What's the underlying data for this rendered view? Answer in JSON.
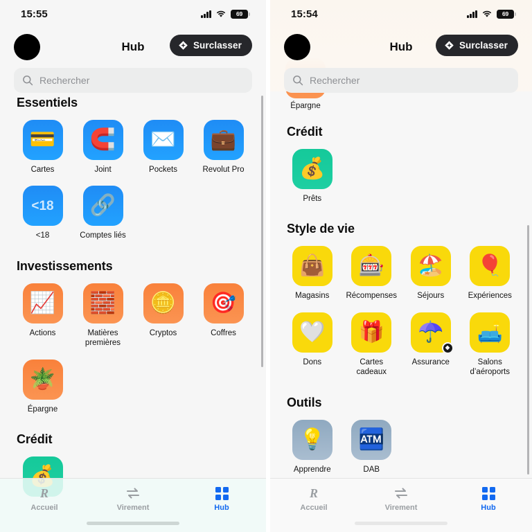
{
  "app": {
    "name": "Revolut",
    "screen": "Hub"
  },
  "left": {
    "status": {
      "time": "15:55",
      "battery": "69",
      "signal_icon": "cellular-signal-icon",
      "wifi_icon": "wifi-icon",
      "battery_icon": "battery-icon"
    },
    "header": {
      "title": "Hub",
      "avatar_name": "user-avatar",
      "upgrade_label": "Surclasser",
      "upgrade_icon": "diamond-icon"
    },
    "search": {
      "placeholder": "Rechercher",
      "icon": "search-icon"
    },
    "sections": [
      {
        "title": "Essentiels",
        "color": "#22a2ff",
        "items": [
          {
            "label": "Cartes",
            "icon": "credit-card-icon",
            "glyph": "💳",
            "bg": "bg-blue"
          },
          {
            "label": "Joint",
            "icon": "magnet-icon",
            "glyph": "🧲",
            "bg": "bg-blue"
          },
          {
            "label": "Pockets",
            "icon": "envelope-icon",
            "glyph": "✉️",
            "bg": "bg-blue"
          },
          {
            "label": "Revolut Pro",
            "icon": "briefcase-icon",
            "glyph": "💼",
            "bg": "bg-blue"
          },
          {
            "label": "<18",
            "icon": "under-18-icon",
            "glyph": "<18",
            "bg": "bg-blue"
          },
          {
            "label": "Comptes liés",
            "icon": "link-icon",
            "glyph": "🔗",
            "bg": "bg-blue"
          }
        ]
      },
      {
        "title": "Investissements",
        "color": "#fb9452",
        "items": [
          {
            "label": "Actions",
            "icon": "stock-chart-icon",
            "glyph": "📈",
            "bg": "bg-orange"
          },
          {
            "label": "Matières premières",
            "icon": "gold-bars-icon",
            "glyph": "🧱",
            "bg": "bg-orange"
          },
          {
            "label": "Cryptos",
            "icon": "coins-icon",
            "glyph": "🪙",
            "bg": "bg-orange"
          },
          {
            "label": "Coffres",
            "icon": "safe-vault-icon",
            "glyph": "🎯",
            "bg": "bg-orange"
          },
          {
            "label": "Épargne",
            "icon": "plant-pot-icon",
            "glyph": "🪴",
            "bg": "bg-orange"
          }
        ]
      },
      {
        "title": "Crédit",
        "color": "#1ecfa2",
        "items": [
          {
            "label": "",
            "icon": "money-bag-icon",
            "glyph": "💰",
            "bg": "bg-green"
          }
        ]
      }
    ],
    "tabs": [
      {
        "label": "Accueil",
        "icon": "revolut-r-icon",
        "active": false
      },
      {
        "label": "Virement",
        "icon": "transfer-arrows-icon",
        "active": false
      },
      {
        "label": "Hub",
        "icon": "grid-squares-icon",
        "active": true
      }
    ]
  },
  "right": {
    "status": {
      "time": "15:54",
      "battery": "69",
      "signal_icon": "cellular-signal-icon",
      "wifi_icon": "wifi-icon",
      "battery_icon": "battery-icon"
    },
    "header": {
      "title": "Hub",
      "avatar_name": "user-avatar",
      "upgrade_label": "Surclasser",
      "upgrade_icon": "diamond-icon"
    },
    "search": {
      "placeholder": "Rechercher",
      "icon": "search-icon"
    },
    "partial_top": {
      "label": "Épargne",
      "icon": "plant-pot-icon",
      "glyph": "🪴",
      "bg": "bg-orange"
    },
    "sections": [
      {
        "title": "Crédit",
        "color": "#1ecfa2",
        "items": [
          {
            "label": "Prêts",
            "icon": "money-bag-icon",
            "glyph": "💰",
            "bg": "bg-green"
          }
        ]
      },
      {
        "title": "Style de vie",
        "color": "#f9d90b",
        "items": [
          {
            "label": "Magasins",
            "icon": "shopping-bag-icon",
            "glyph": "👜",
            "bg": "bg-yellow"
          },
          {
            "label": "Récompenses",
            "icon": "rewards-icon",
            "glyph": "🎰",
            "bg": "bg-yellow"
          },
          {
            "label": "Séjours",
            "icon": "beach-house-icon",
            "glyph": "🏖️",
            "bg": "bg-yellow"
          },
          {
            "label": "Expériences",
            "icon": "hot-air-balloon-icon",
            "glyph": "🎈",
            "bg": "bg-yellow"
          },
          {
            "label": "Dons",
            "icon": "heart-icon",
            "glyph": "🤍",
            "bg": "bg-yellow"
          },
          {
            "label": "Cartes cadeaux",
            "icon": "gift-icon",
            "glyph": "🎁",
            "bg": "bg-yellow"
          },
          {
            "label": "Assurance",
            "icon": "umbrella-icon",
            "glyph": "☂️",
            "bg": "bg-yellow",
            "badge": "diamond-badge-icon"
          },
          {
            "label": "Salons d’aéroports",
            "icon": "armchair-icon",
            "glyph": "🛋️",
            "bg": "bg-yellow"
          }
        ]
      },
      {
        "title": "Outils",
        "color": "#a9bdd0",
        "items": [
          {
            "label": "Apprendre",
            "icon": "lightbulb-icon",
            "glyph": "💡",
            "bg": "bg-steel"
          },
          {
            "label": "DAB",
            "icon": "atm-icon",
            "glyph": "🏧",
            "bg": "bg-steel"
          }
        ]
      }
    ],
    "tabs": [
      {
        "label": "Accueil",
        "icon": "revolut-r-icon",
        "active": false
      },
      {
        "label": "Virement",
        "icon": "transfer-arrows-icon",
        "active": false
      },
      {
        "label": "Hub",
        "icon": "grid-squares-icon",
        "active": true
      }
    ]
  }
}
